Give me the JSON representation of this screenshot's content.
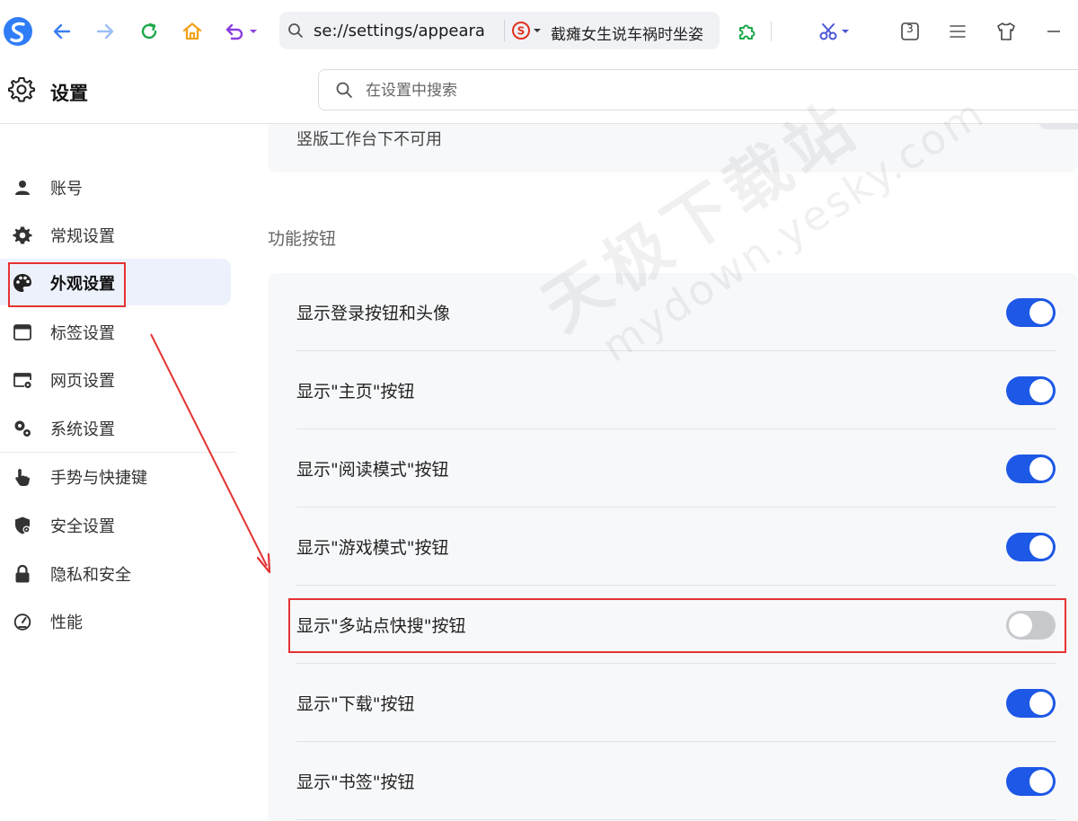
{
  "toolbar": {
    "address_url": "se://settings/appeara",
    "suggest_text": "截瘫女生说车祸时坐姿",
    "tab_count": "3"
  },
  "header": {
    "title": "设置",
    "search_placeholder": "在设置中搜索"
  },
  "sidebar": {
    "items": [
      {
        "label": "账号",
        "icon": "user-icon"
      },
      {
        "label": "常规设置",
        "icon": "gear-icon"
      },
      {
        "label": "外观设置",
        "icon": "palette-icon",
        "active": true
      },
      {
        "label": "标签设置",
        "icon": "tab-window-icon"
      },
      {
        "label": "网页设置",
        "icon": "webpage-gear-icon"
      },
      {
        "label": "系统设置",
        "icon": "system-gears-icon"
      },
      {
        "label": "手势与快捷键",
        "icon": "hand-pointer-icon"
      },
      {
        "label": "安全设置",
        "icon": "shield-icon"
      },
      {
        "label": "隐私和安全",
        "icon": "lock-icon"
      },
      {
        "label": "性能",
        "icon": "speedometer-icon"
      }
    ]
  },
  "main": {
    "top_note": "竖版工作台下不可用",
    "section_title": "功能按钮",
    "rows": [
      {
        "label": "显示登录按钮和头像",
        "on": true
      },
      {
        "label": "显示\"主页\"按钮",
        "on": true
      },
      {
        "label": "显示\"阅读模式\"按钮",
        "on": true
      },
      {
        "label": "显示\"游戏模式\"按钮",
        "on": true
      },
      {
        "label": "显示\"多站点快搜\"按钮",
        "on": false
      },
      {
        "label": "显示\"下载\"按钮",
        "on": true
      },
      {
        "label": "显示\"书签\"按钮",
        "on": true
      }
    ]
  },
  "watermark": {
    "cn": "天极下载站",
    "en": "mydown.yesky.com"
  },
  "colors": {
    "accent": "#1d58e6",
    "toggle_off": "#c8c9cc",
    "annotation": "#e53333",
    "active_nav_bg": "#edf1fb"
  }
}
